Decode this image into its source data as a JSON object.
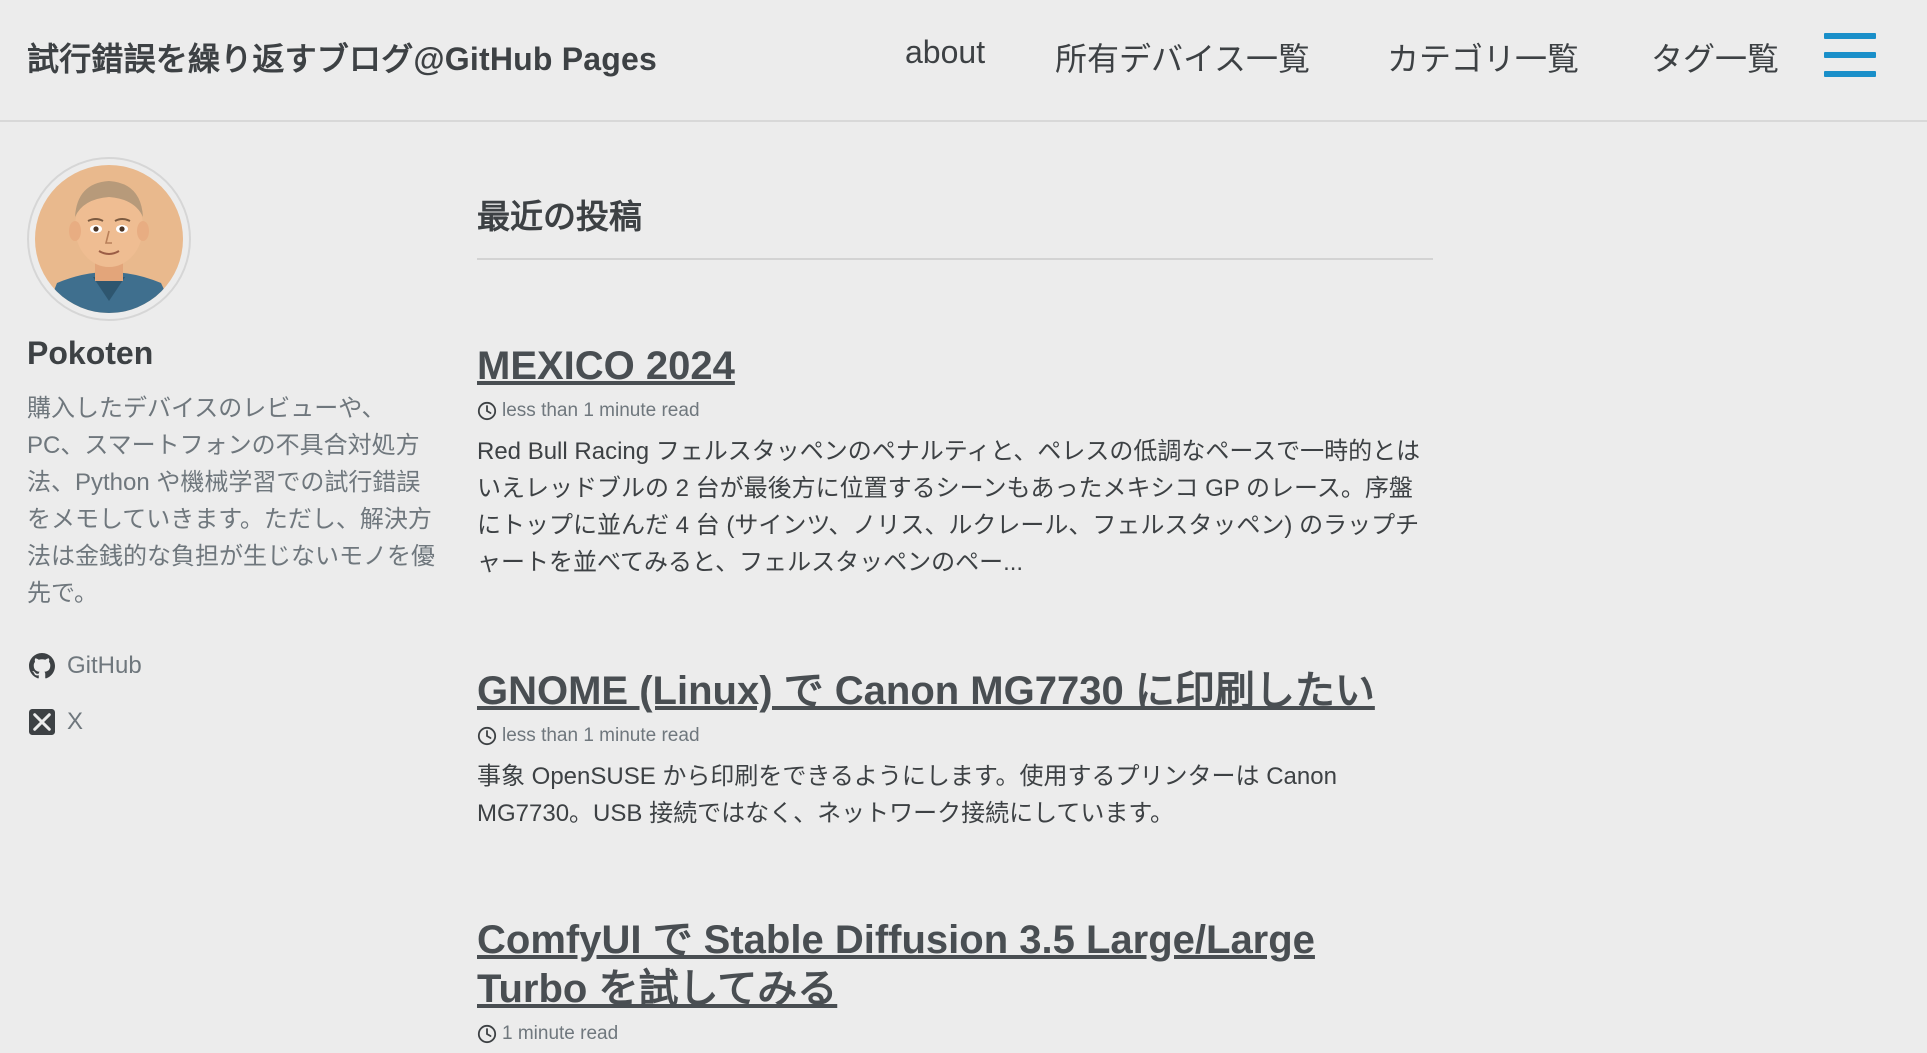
{
  "site": {
    "title": "試行錯誤を繰り返すブログ@GitHub Pages"
  },
  "nav": {
    "items": [
      {
        "label": "about"
      },
      {
        "label": "所有デバイス一覧"
      },
      {
        "label": "カテゴリ一覧"
      },
      {
        "label": "タグ一覧"
      }
    ],
    "menu_icon": "hamburger-icon",
    "accent_color": "#1a8fc9"
  },
  "author": {
    "name": "Pokoten",
    "bio": "購入したデバイスのレビューや、PC、スマートフォンの不具合対処方法、Python や機械学習での試行錯誤をメモしていきます。ただし、解決方法は金銭的な負担が生じないモノを優先で。",
    "links": [
      {
        "label": "GitHub",
        "icon": "github-icon"
      },
      {
        "label": "X",
        "icon": "x-icon"
      }
    ]
  },
  "main": {
    "heading": "最近の投稿",
    "posts": [
      {
        "title": "MEXICO 2024",
        "read_time": "less than 1 minute read",
        "excerpt": "Red Bull Racing フェルスタッペンのペナルティと、ペレスの低調なペースで一時的とはいえレッドブルの 2 台が最後方に位置するシーンもあったメキシコ GP のレース。序盤にトップに並んだ 4 台 (サインツ、ノリス、ルクレール、フェルスタッペン) のラップチャートを並べてみると、フェルスタッペンのペー..."
      },
      {
        "title": "GNOME (Linux) で Canon MG7730 に印刷したい",
        "read_time": "less than 1 minute read",
        "excerpt": "事象 OpenSUSE から印刷をできるようにします。使用するプリンターは Canon MG7730。USB 接続ではなく、ネットワーク接続にしています。"
      },
      {
        "title": "ComfyUI で Stable Diffusion 3.5 Large/Large Turbo を試してみる",
        "read_time": "1 minute read",
        "excerpt": ""
      }
    ]
  }
}
